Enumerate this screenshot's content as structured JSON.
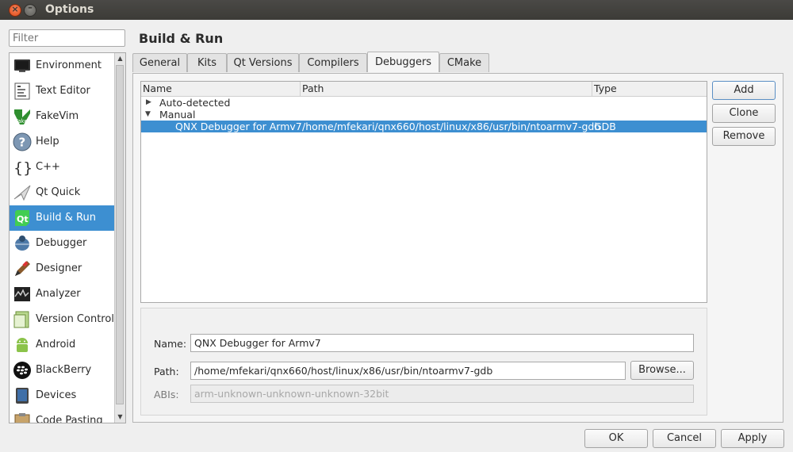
{
  "window": {
    "title": "Options"
  },
  "filter": {
    "placeholder": "Filter"
  },
  "categories": [
    {
      "label": "Environment",
      "icon": "monitor-icon"
    },
    {
      "label": "Text Editor",
      "icon": "text-editor-icon"
    },
    {
      "label": "FakeVim",
      "icon": "fakevim-icon"
    },
    {
      "label": "Help",
      "icon": "help-icon"
    },
    {
      "label": "C++",
      "icon": "cpp-braces-icon"
    },
    {
      "label": "Qt Quick",
      "icon": "qt-quick-icon"
    },
    {
      "label": "Build & Run",
      "icon": "build-run-icon",
      "selected": true
    },
    {
      "label": "Debugger",
      "icon": "debugger-icon"
    },
    {
      "label": "Designer",
      "icon": "designer-icon"
    },
    {
      "label": "Analyzer",
      "icon": "analyzer-icon"
    },
    {
      "label": "Version Control",
      "icon": "version-control-icon"
    },
    {
      "label": "Android",
      "icon": "android-icon"
    },
    {
      "label": "BlackBerry",
      "icon": "blackberry-icon"
    },
    {
      "label": "Devices",
      "icon": "devices-icon"
    },
    {
      "label": "Code Pasting",
      "icon": "code-pasting-icon"
    }
  ],
  "page": {
    "title": "Build & Run"
  },
  "tabs": [
    "General",
    "Kits",
    "Qt Versions",
    "Compilers",
    "Debuggers",
    "CMake"
  ],
  "active_tab": "Debuggers",
  "tree": {
    "columns": [
      "Name",
      "Path",
      "Type"
    ],
    "groups": [
      {
        "label": "Auto-detected",
        "expanded": false
      },
      {
        "label": "Manual",
        "expanded": true
      }
    ],
    "rows": [
      {
        "name": "QNX Debugger for Armv7",
        "path": "/home/mfekari/qnx660/host/linux/x86/usr/bin/ntoarmv7-gdb",
        "type": "GDB",
        "selected": true
      }
    ]
  },
  "side_buttons": {
    "add": "Add",
    "clone": "Clone",
    "remove": "Remove"
  },
  "details": {
    "name_label": "Name:",
    "name_value": "QNX Debugger for Armv7",
    "path_label": "Path:",
    "path_value": "/home/mfekari/qnx660/host/linux/x86/usr/bin/ntoarmv7-gdb",
    "browse_label": "Browse...",
    "abis_label": "ABIs:",
    "abis_value": "arm-unknown-unknown-unknown-32bit"
  },
  "dialog_buttons": {
    "ok": "OK",
    "cancel": "Cancel",
    "apply": "Apply"
  },
  "colors": {
    "selection": "#3d8fd1",
    "titlebar": "#3c3b37"
  }
}
